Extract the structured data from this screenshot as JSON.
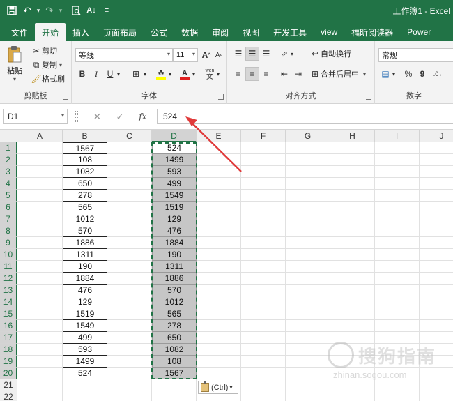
{
  "title": "工作簿1 - Excel",
  "tabs": [
    "文件",
    "开始",
    "插入",
    "页面布局",
    "公式",
    "数据",
    "审阅",
    "视图",
    "开发工具",
    "view",
    "福昕阅读器",
    "Power"
  ],
  "active_tab": "开始",
  "clipboard": {
    "paste": "粘贴",
    "cut": "剪切",
    "copy": "复制",
    "format_painter": "格式刷",
    "group_label": "剪贴板"
  },
  "font": {
    "name": "等线",
    "size": "11",
    "bold": "B",
    "italic": "I",
    "underline": "U",
    "wen": "wén",
    "group_label": "字体"
  },
  "alignment": {
    "wrap_text": "自动换行",
    "merge_center": "合并后居中",
    "group_label": "对齐方式"
  },
  "number": {
    "format": "常规",
    "percent": "%",
    "comma": "9",
    "group_label": "数字"
  },
  "formula_bar": {
    "name_box": "D1",
    "value": "524",
    "fx": "fx"
  },
  "columns": [
    "A",
    "B",
    "C",
    "D",
    "E",
    "F",
    "G",
    "H",
    "I",
    "J"
  ],
  "selected_column": "D",
  "rows": [
    "1",
    "2",
    "3",
    "4",
    "5",
    "6",
    "7",
    "8",
    "9",
    "10",
    "11",
    "12",
    "13",
    "14",
    "15",
    "16",
    "17",
    "18",
    "19",
    "20",
    "21",
    "22"
  ],
  "column_b": [
    "1567",
    "108",
    "1082",
    "650",
    "278",
    "565",
    "1012",
    "570",
    "1886",
    "1311",
    "190",
    "1884",
    "476",
    "129",
    "1519",
    "1549",
    "499",
    "593",
    "1499",
    "524"
  ],
  "column_d": [
    "524",
    "1499",
    "593",
    "499",
    "1549",
    "1519",
    "129",
    "476",
    "1884",
    "190",
    "1311",
    "1886",
    "570",
    "1012",
    "565",
    "278",
    "650",
    "1082",
    "108",
    "1567"
  ],
  "paste_options": "(Ctrl)",
  "watermark": {
    "main": "搜狗指南",
    "sub": "zhinan.sogou.com"
  }
}
